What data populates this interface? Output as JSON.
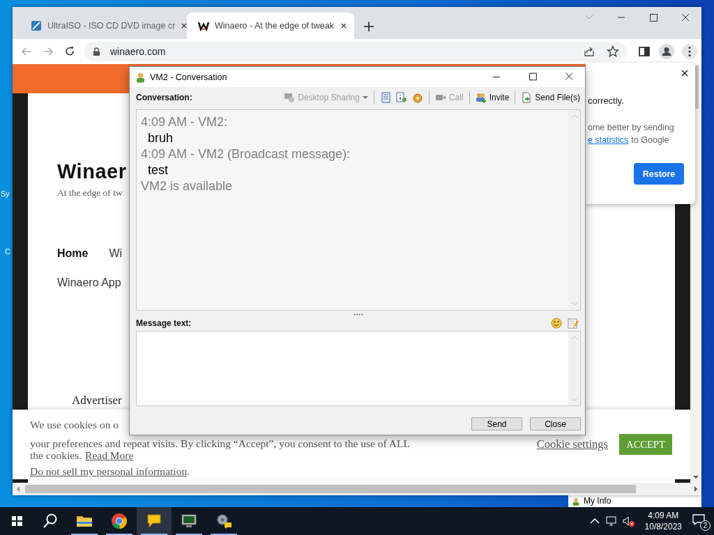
{
  "desktop": {
    "icon_labels": [
      "Sy",
      "C"
    ]
  },
  "browser": {
    "tabs": [
      {
        "title": "UltraISO - ISO CD DVD image cr",
        "selected": false
      },
      {
        "title": "Winaero - At the edge of tweak",
        "selected": true
      }
    ],
    "new_tab": "+",
    "address": "winaero.com"
  },
  "page": {
    "site_title": "Winaer",
    "tagline": "At the edge of tw",
    "nav": [
      {
        "label": "Home",
        "selected": true
      },
      {
        "label": "Wi",
        "selected": false
      }
    ],
    "sub_nav": "Winaero App",
    "ad_label": "Advertiser"
  },
  "cookie_banner": {
    "lines": [
      "We use cookies on o",
      "your preferences and repeat visits. By clicking “Accept”, you consent to the use of ALL"
    ],
    "last_line": "the cookies.",
    "read_more": "Read More",
    "do_not_sell": "Do not sell my personal information",
    "do_not_sell_end": ".",
    "settings_link": "Cookie settings",
    "accept_button": "ACCEPT"
  },
  "popup": {
    "line_1": "correctly.",
    "line_2": "ome better by sending",
    "link": "e statistics",
    "line_3_rest": "to Google",
    "button": "Restore"
  },
  "conversation_window": {
    "title": "VM2 - Conversation",
    "conversation_label": "Conversation:",
    "toolbar": [
      {
        "kind": "dropdown",
        "label": "Desktop Sharing",
        "disabled": true
      },
      {
        "kind": "notes"
      },
      {
        "kind": "info"
      },
      {
        "kind": "plugin"
      },
      {
        "kind": "call",
        "label": "Call",
        "disabled": true
      },
      {
        "kind": "invite",
        "label": "Invite",
        "disabled": false
      },
      {
        "kind": "send_files",
        "label": "Send File(s)",
        "disabled": false
      }
    ],
    "log": [
      {
        "kind": "message",
        "header": "4:09 AM - VM2:",
        "body": "bruh"
      },
      {
        "kind": "message",
        "header": "4:09 AM - VM2 (Broadcast message):",
        "body": "test"
      },
      {
        "kind": "status",
        "text": "VM2 is available"
      }
    ],
    "message_label": "Message text:",
    "buttons": [
      "Send",
      "Close"
    ]
  },
  "my_info": {
    "label": "My Info"
  },
  "taskbar": {
    "apps": [
      {
        "kind": "explorer",
        "running": true,
        "active": false
      },
      {
        "kind": "chrome",
        "running": true,
        "active": false
      },
      {
        "kind": "chat",
        "running": true,
        "active": true
      },
      {
        "kind": "monitor",
        "running": true,
        "active": false
      },
      {
        "kind": "gear",
        "running": true,
        "active": false
      }
    ],
    "time": "4:09 AM",
    "date": "10/8/2023",
    "notifications": "2"
  }
}
